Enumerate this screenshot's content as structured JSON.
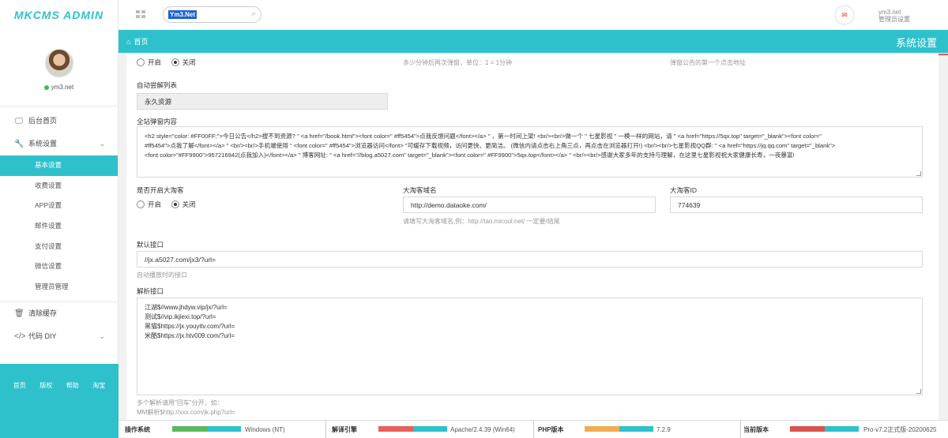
{
  "app": {
    "logo": "MKCMS ADMIN",
    "search_value": "Ym3.Net",
    "user_name": "ym3.net",
    "user_role": "管理员设置",
    "breadcrumb_home": "首页",
    "page_title": "系统设置"
  },
  "profile": {
    "name": "ym3.net"
  },
  "sidebar": {
    "items": [
      {
        "label": "后台首页",
        "icon": "monitor-icon"
      },
      {
        "label": "系统设置",
        "icon": "wrench-icon"
      }
    ],
    "subitems": [
      "基本设置",
      "收费设置",
      "APP设置",
      "邮件设置",
      "支付设置",
      "微信设置",
      "管理员管理"
    ],
    "active_subitem": "基本设置",
    "bottom_items": [
      {
        "label": "清除缓存",
        "icon": "trash-icon"
      },
      {
        "label": "代码 DIY",
        "icon": "code-icon"
      }
    ],
    "footer_links": [
      "首页",
      "版权",
      "帮助",
      "淘宝"
    ]
  },
  "form": {
    "popup_toggle": {
      "on": "开启",
      "off": "关闭",
      "selected": "关闭"
    },
    "popup_interval_hint": "多少分钟后再次弹窗，单位：1 = 1分钟",
    "popup_link_hint": "弹窗公告的第一个点击地址",
    "auto_parse_label": "自动尝解列表",
    "auto_parse_value": "永久资源",
    "site_popup_label": "全站弹窗内容",
    "site_popup_lines": [
      "<h2 style=\"color: #FF00FF;\">今日公告</h2>搜不到资源? \" <a href=\"/book.html\"><font color=\" #ff5454\">点我反馈问题</font></a> \" ，第一时间上架! <br/><br/>做一个 \" 七星影视 \" 一模一样的网站，请 \" <a href=\"https://5qx.top\" target=\"_blank\"><font color=\"",
      "#ff5454\">点我了解</font></a> \" <br/><br/>手机端使用 \" <font color=\" #ff5454\">浏览器访问</font> \"可缓存下载视频，访问更快、更简洁。 (微信内请点击右上角三点，再点击在浏览器打开!) <br/><br/>七星影视QQ群: \" <a href=\"https://jq.qq.com\" target=\"_blank\">",
      "<font color=\"#FF9900\">957216942(点我加入)</font></a> \" 博客网址: \" <a href=\"//blog.a5027.com\" target=\"_blank\"><font color=\" #FF9900\">5qx.top</font></a> \" <br/><br/>感谢大家多年的支持与理解，在这里七星影视祝大家健康长寿，一夜暴富!"
    ],
    "taoke_label": "是否开启大淘客",
    "taoke_toggle": {
      "on": "开启",
      "off": "关闭",
      "selected": "关闭"
    },
    "taoke_domain_label": "大淘客域名",
    "taoke_domain_value": "http://demo.dataoke.com/",
    "taoke_domain_hint": "请填写大淘客域名,例：http://tao.micool.net/ 一定要/结尾",
    "taoke_id_label": "大淘客ID",
    "taoke_id_value": "774639",
    "default_api_label": "默认接口",
    "default_api_value": "//jx.a5027.com/jx3/?url=",
    "default_api_hint": "自动播放时的接口",
    "parse_api_label": "解析接口",
    "parse_api_lines": [
      "江湖$//www.jhdyw.vip/jx/?url=",
      "测试$//vip.ikjiexi.top/?url=",
      "黑猫$https://jx.youyitv.com/?url=",
      "米酷$https://jx.htv009.com/?url="
    ],
    "parse_api_hint1": "多个解析请用\"回车\"分开，如：",
    "parse_api_hint2": "MM解析$http://xxx.com/jk.php?url="
  },
  "status": {
    "os": {
      "label": "操作系统",
      "value": "Windows (NT)",
      "colors": [
        "#5cb85c",
        "#2ec1cc"
      ]
    },
    "engine": {
      "label": "解译引擎",
      "value": "Apache/2.4.39 (Win64)",
      "colors": [
        "#e9605a",
        "#2ec1cc"
      ]
    },
    "php": {
      "label": "PHP版本",
      "value": "7.2.9",
      "colors": [
        "#f0ad4e",
        "#2ec1cc"
      ]
    },
    "version": {
      "label": "当前版本",
      "value": "Pro-v7.2正式版-20200625",
      "colors": [
        "#d9534f",
        "#2ec1cc"
      ]
    }
  },
  "colors": {
    "accent": "#2ec1cc",
    "mail": "#e03535"
  }
}
